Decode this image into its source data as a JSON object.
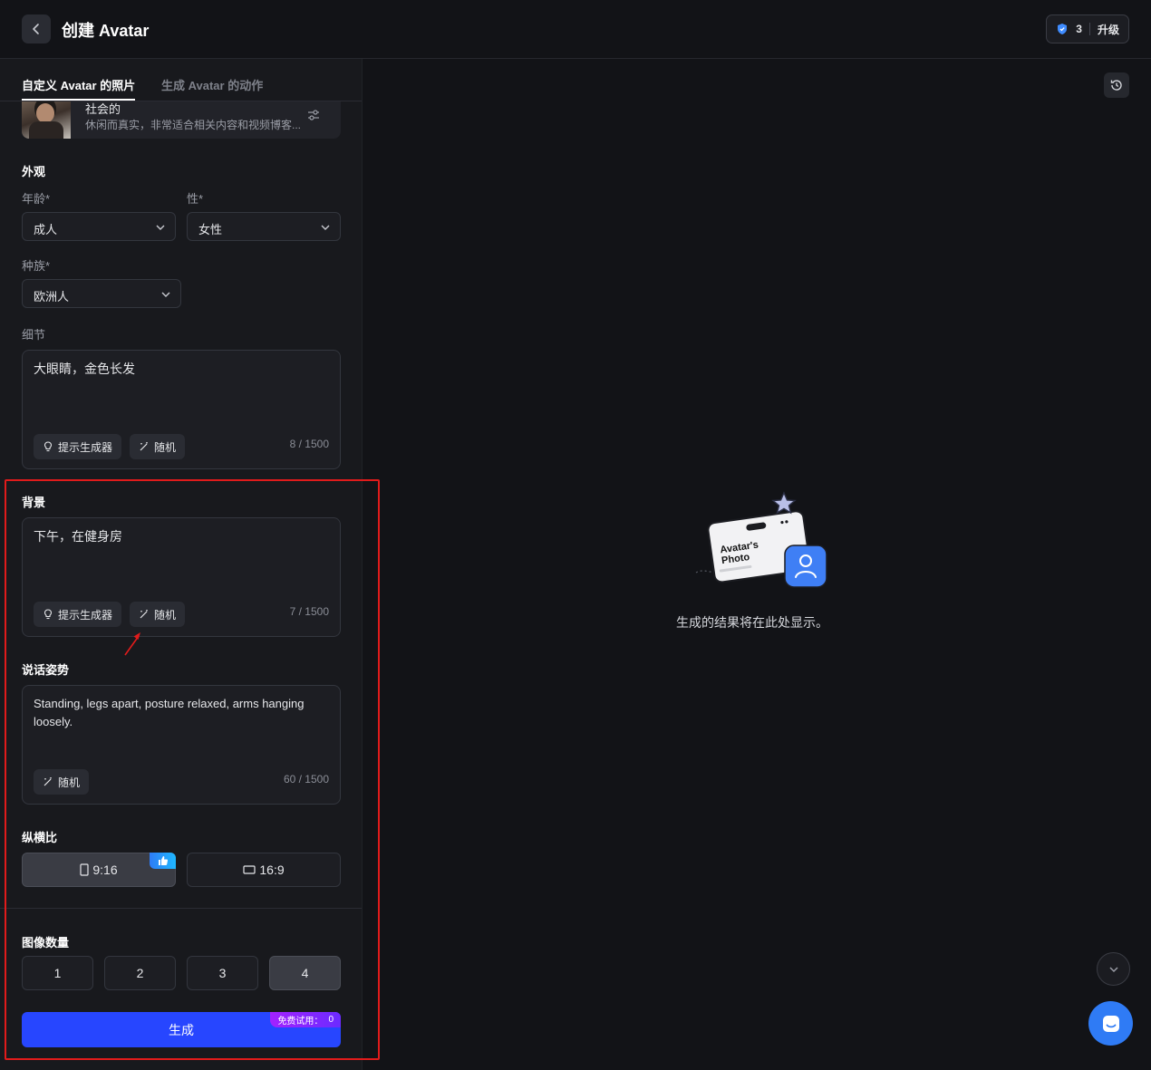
{
  "header": {
    "title": "创建 Avatar",
    "credits": "3",
    "upgrade": "升级"
  },
  "tabs": [
    {
      "label": "自定义 Avatar 的照片"
    },
    {
      "label": "生成 Avatar 的动作"
    }
  ],
  "style_card": {
    "name": "社会的",
    "desc": "休闲而真实，非常适合相关内容和视频博客..."
  },
  "appearance": {
    "title": "外观",
    "age_label": "年龄*",
    "age_value": "成人",
    "gender_label": "性*",
    "gender_value": "女性",
    "ethnicity_label": "种族*",
    "ethnicity_value": "欧洲人"
  },
  "details": {
    "label": "细节",
    "text": "大眼睛，金色长发",
    "prompt_btn": "提示生成器",
    "random_btn": "随机",
    "counter": "8 / 1500"
  },
  "background": {
    "title": "背景",
    "text": "下午，在健身房",
    "prompt_btn": "提示生成器",
    "random_btn": "随机",
    "counter": "7 / 1500"
  },
  "pose": {
    "title": "说话姿势",
    "text": "Standing, legs apart, posture relaxed, arms hanging loosely.",
    "random_btn": "随机",
    "counter": "60 / 1500"
  },
  "aspect": {
    "title": "纵横比",
    "options": [
      {
        "label": "9:16",
        "selected": true
      },
      {
        "label": "16:9",
        "selected": false
      }
    ]
  },
  "image_count": {
    "title": "图像数量",
    "options": [
      "1",
      "2",
      "3",
      "4"
    ],
    "selected": "4"
  },
  "generate": {
    "label": "生成",
    "trial_label": "免费试用：",
    "trial_count": "0"
  },
  "result": {
    "placeholder": "生成的结果将在此处显示。",
    "illustration_line1": "Avatar's",
    "illustration_line2": "Photo"
  },
  "colors": {
    "accent": "#2746ff",
    "highlight": "#e11b1b",
    "chat": "#2f7bf5"
  }
}
